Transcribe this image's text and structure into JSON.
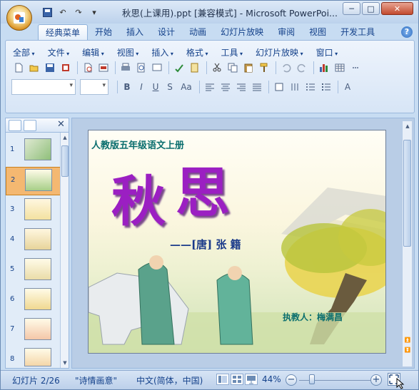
{
  "window": {
    "title": "秋思(上课用).ppt [兼容模式] - Microsoft PowerPoi...",
    "minimize": "─",
    "maximize": "□",
    "close": "✕"
  },
  "quick_access": {
    "undo": "↶",
    "redo": "↷",
    "customize": "▾"
  },
  "ribbon_tabs": [
    "经典菜单",
    "开始",
    "插入",
    "设计",
    "动画",
    "幻灯片放映",
    "审阅",
    "视图",
    "开发工具"
  ],
  "help": "?",
  "classic_menus": [
    "全部",
    "文件",
    "编辑",
    "视图",
    "插入",
    "格式",
    "工具",
    "幻灯片放映",
    "窗口"
  ],
  "format_buttons": [
    "B",
    "I",
    "U",
    "S",
    "Aa"
  ],
  "slide_panel": {
    "close": "✕",
    "slides": [
      {
        "num": "1"
      },
      {
        "num": "2"
      },
      {
        "num": "3"
      },
      {
        "num": "4"
      },
      {
        "num": "5"
      },
      {
        "num": "6"
      },
      {
        "num": "7"
      },
      {
        "num": "8"
      }
    ]
  },
  "slide": {
    "textbook": "人教版五年级语文上册",
    "title_chars": [
      "秋",
      "思"
    ],
    "author_line": "——[唐] 张 籍",
    "teacher": "执教人：梅满昌"
  },
  "statusbar": {
    "slide_indicator": "幻灯片 2/26",
    "theme": "\"诗情画意\"",
    "language": "中文(简体，中国)",
    "zoom": "44%",
    "zoom_minus": "−",
    "zoom_plus": "+"
  },
  "colors": {
    "title_purple": "#9b1fc2",
    "teal_text": "#0a6e6e",
    "accent_blue": "#15428b"
  }
}
